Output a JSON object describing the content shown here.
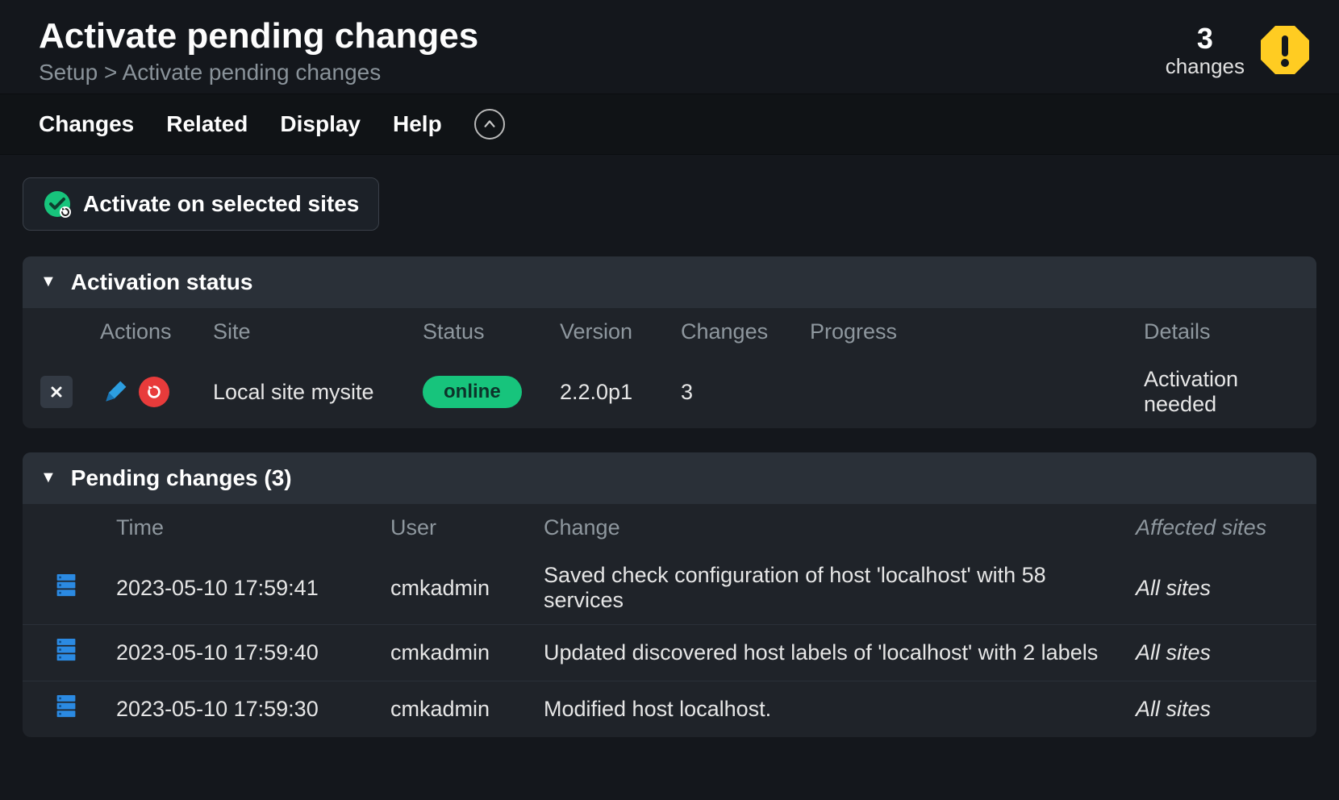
{
  "header": {
    "title": "Activate pending changes",
    "breadcrumb": "Setup > Activate pending changes",
    "changes_count": "3",
    "changes_label": "changes"
  },
  "tabs": {
    "changes": "Changes",
    "related": "Related",
    "display": "Display",
    "help": "Help"
  },
  "toolbar": {
    "activate_label": "Activate on selected sites"
  },
  "panels": {
    "activation": {
      "title": "Activation status",
      "columns": {
        "actions": "Actions",
        "site": "Site",
        "status": "Status",
        "version": "Version",
        "changes": "Changes",
        "progress": "Progress",
        "details": "Details"
      },
      "rows": [
        {
          "site": "Local site mysite",
          "status": "online",
          "version": "2.2.0p1",
          "changes": "3",
          "progress": "",
          "details": "Activation needed"
        }
      ]
    },
    "pending": {
      "title": "Pending changes (3)",
      "columns": {
        "time": "Time",
        "user": "User",
        "change": "Change",
        "affected": "Affected sites"
      },
      "rows": [
        {
          "time": "2023-05-10 17:59:41",
          "user": "cmkadmin",
          "change": "Saved check configuration of host 'localhost' with 58 services",
          "affected": "All sites"
        },
        {
          "time": "2023-05-10 17:59:40",
          "user": "cmkadmin",
          "change": "Updated discovered host labels of 'localhost' with 2 labels",
          "affected": "All sites"
        },
        {
          "time": "2023-05-10 17:59:30",
          "user": "cmkadmin",
          "change": "Modified host localhost.",
          "affected": "All sites"
        }
      ]
    }
  },
  "colors": {
    "status_online_bg": "#17c47c",
    "warn_badge": "#ffcc22",
    "restart_icon": "#e83b3b",
    "edit_icon": "#2c9ee0",
    "host_icon": "#2b8ae2"
  }
}
